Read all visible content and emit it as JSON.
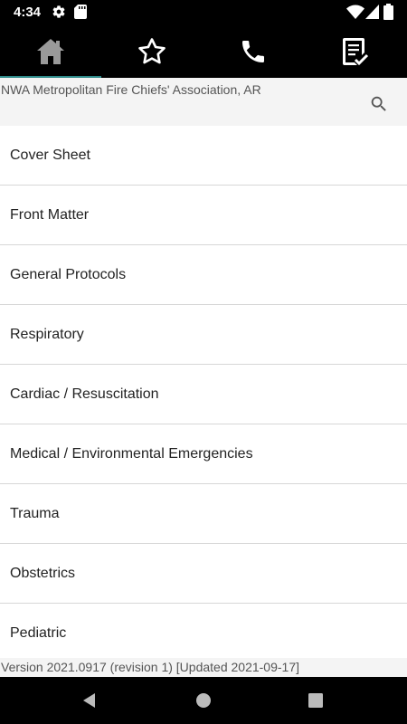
{
  "status_bar": {
    "time": "4:34",
    "icons": [
      "gear-icon",
      "sd-card-icon",
      "wifi-icon",
      "cellular-signal-icon",
      "battery-icon"
    ]
  },
  "tabs": [
    {
      "icon": "home-icon",
      "selected": true
    },
    {
      "icon": "star-icon",
      "selected": false
    },
    {
      "icon": "phone-icon",
      "selected": false
    },
    {
      "icon": "checklist-icon",
      "selected": false
    }
  ],
  "header": {
    "title": "NWA Metropolitan Fire Chiefs' Association, AR",
    "search_icon": "search-icon"
  },
  "list": {
    "items": [
      {
        "label": "Cover Sheet"
      },
      {
        "label": "Front Matter"
      },
      {
        "label": "General Protocols"
      },
      {
        "label": "Respiratory"
      },
      {
        "label": "Cardiac / Resuscitation"
      },
      {
        "label": "Medical / Environmental Emergencies"
      },
      {
        "label": "Trauma"
      },
      {
        "label": "Obstetrics"
      },
      {
        "label": "Pediatric"
      }
    ]
  },
  "footer": {
    "version": "Version 2021.0917 (revision 1) [Updated 2021-09-17]"
  },
  "nav_bar": {
    "icons": [
      "back-icon",
      "home-circle-icon",
      "recents-icon"
    ]
  },
  "colors": {
    "accent": "#2e8b8a",
    "header_bg": "#f4f4f4",
    "divider": "#d7d7d7"
  }
}
